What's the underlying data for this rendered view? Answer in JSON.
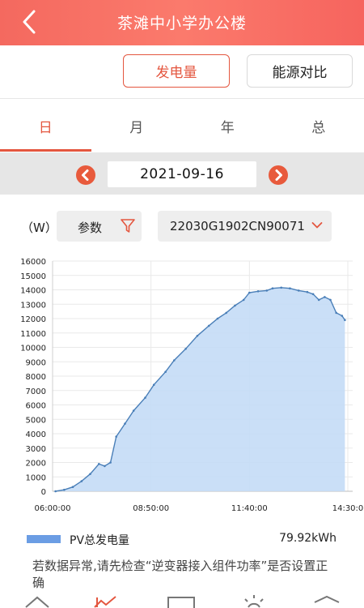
{
  "header": {
    "title": "茶滩中小学办公楼",
    "back_icon": "chevron-left-icon"
  },
  "segments": [
    {
      "label": "发电量",
      "active": true
    },
    {
      "label": "能源对比",
      "active": false
    }
  ],
  "tabs": [
    {
      "label": "日",
      "active": true
    },
    {
      "label": "月",
      "active": false
    },
    {
      "label": "年",
      "active": false
    },
    {
      "label": "总",
      "active": false
    }
  ],
  "date_nav": {
    "date": "2021-09-16",
    "prev_icon": "chevron-left-circle-icon",
    "next_icon": "chevron-right-circle-icon"
  },
  "filters": {
    "unit": "（W）",
    "param_label": "参数",
    "param_icon": "filter-icon",
    "device": "22030G1902CN90071",
    "device_icon": "chevron-down-icon"
  },
  "colors": {
    "accent": "#e4563f",
    "header": "#f86d62",
    "series_fill": "#c4dcf6",
    "series_line": "#4a7fb8"
  },
  "chart_data": {
    "type": "area",
    "x_tick_labels": [
      "06:00:00",
      "08:50:00",
      "11:40:00",
      "14:30:0"
    ],
    "x_range": [
      "06:00",
      "14:30"
    ],
    "ylim": [
      0,
      16000
    ],
    "y_ticks": [
      0,
      1000,
      2000,
      3000,
      4000,
      5000,
      6000,
      7000,
      8000,
      9000,
      10000,
      11000,
      12000,
      13000,
      14000,
      15000,
      16000
    ],
    "grid": true,
    "series": [
      {
        "name": "PV总发电量",
        "points": [
          [
            "06:05",
            0
          ],
          [
            "06:20",
            100
          ],
          [
            "06:35",
            300
          ],
          [
            "06:50",
            700
          ],
          [
            "07:05",
            1200
          ],
          [
            "07:20",
            1900
          ],
          [
            "07:30",
            1750
          ],
          [
            "07:40",
            2000
          ],
          [
            "07:50",
            3800
          ],
          [
            "08:05",
            4700
          ],
          [
            "08:20",
            5600
          ],
          [
            "08:40",
            6500
          ],
          [
            "08:55",
            7400
          ],
          [
            "09:15",
            8300
          ],
          [
            "09:30",
            9100
          ],
          [
            "09:50",
            9900
          ],
          [
            "10:10",
            10800
          ],
          [
            "10:30",
            11500
          ],
          [
            "10:45",
            12000
          ],
          [
            "11:00",
            12400
          ],
          [
            "11:15",
            12900
          ],
          [
            "11:30",
            13300
          ],
          [
            "11:40",
            13800
          ],
          [
            "11:55",
            13900
          ],
          [
            "12:10",
            13950
          ],
          [
            "12:20",
            14100
          ],
          [
            "12:35",
            14150
          ],
          [
            "12:50",
            14100
          ],
          [
            "13:05",
            13950
          ],
          [
            "13:20",
            13850
          ],
          [
            "13:30",
            13700
          ],
          [
            "13:40",
            13300
          ],
          [
            "13:50",
            13500
          ],
          [
            "14:00",
            13300
          ],
          [
            "14:10",
            12400
          ],
          [
            "14:20",
            12200
          ],
          [
            "14:25",
            11900
          ]
        ]
      }
    ],
    "legend": {
      "label": "PV总发电量",
      "total": "79.92kWh",
      "position": "bottom"
    }
  },
  "note": "若数据异常,请先检查“逆变器接入组件功率”是否设置正确",
  "bottom_nav_icons": [
    "home-icon",
    "chart-icon",
    "list-icon",
    "bulb-icon",
    "layers-icon"
  ]
}
